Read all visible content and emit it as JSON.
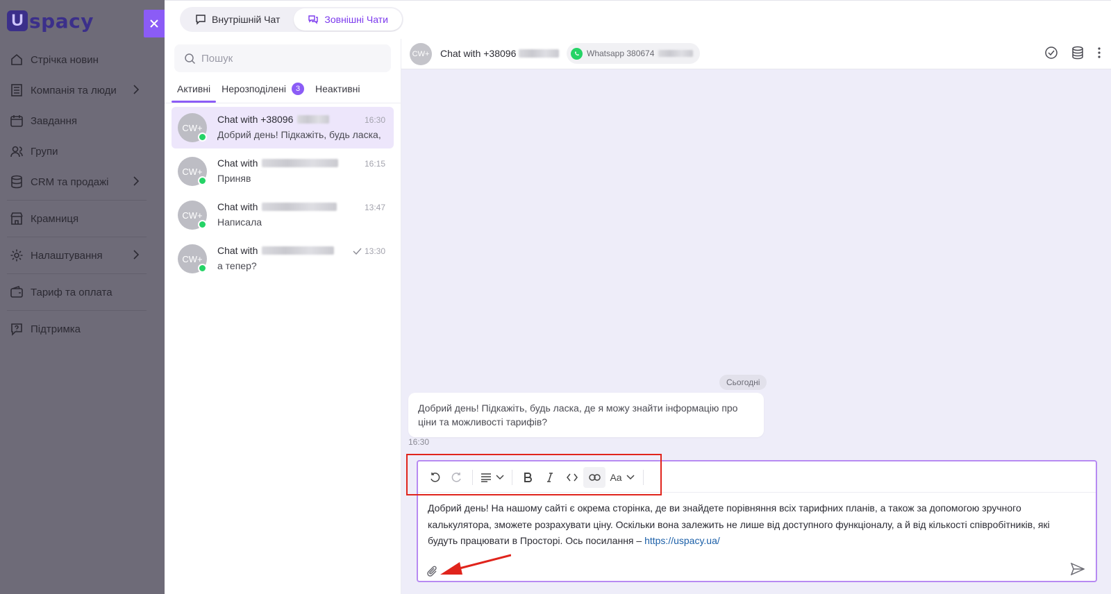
{
  "app": {
    "logo_u": "U",
    "logo_text": "spacy"
  },
  "sidebar": {
    "items": [
      {
        "label": "Стрічка новин",
        "icon": "home-icon"
      },
      {
        "label": "Компанія та люди",
        "icon": "building-icon",
        "chevron": true
      },
      {
        "label": "Завдання",
        "icon": "calendar-icon"
      },
      {
        "label": "Групи",
        "icon": "users-icon"
      },
      {
        "label": "CRM та продажі",
        "icon": "database-icon",
        "chevron": true
      },
      {
        "label": "Крамниця",
        "icon": "store-icon"
      },
      {
        "label": "Налаштування",
        "icon": "gear-icon",
        "chevron": true
      },
      {
        "label": "Тариф та оплата",
        "icon": "wallet-icon"
      },
      {
        "label": "Підтримка",
        "icon": "help-icon"
      }
    ]
  },
  "topbar": {
    "tabs": [
      {
        "label": "Внутрішній Чат",
        "active": false
      },
      {
        "label": "Зовнішні Чати",
        "active": true
      }
    ]
  },
  "chat_list": {
    "search_placeholder": "Пошук",
    "subtabs": [
      {
        "label": "Активні",
        "active": true
      },
      {
        "label": "Нерозподілені",
        "badge": "3"
      },
      {
        "label": "Неактивні"
      }
    ],
    "items": [
      {
        "avatar": "CW+",
        "title": "Chat with +38096",
        "time": "16:30",
        "message": "Добрий день! Підкажіть, будь ласка,",
        "active": true
      },
      {
        "avatar": "CW+",
        "title": "Chat with",
        "time": "16:15",
        "message": "Приняв"
      },
      {
        "avatar": "CW+",
        "title": "Chat with",
        "time": "13:47",
        "message": "Написала"
      },
      {
        "avatar": "CW+",
        "title": "Chat with",
        "time": "13:30",
        "message": "а тепер?",
        "read": true
      }
    ]
  },
  "conversation": {
    "avatar": "CW+",
    "title": "Chat with +38096",
    "channel": "Whatsapp 380674",
    "date_label": "Сьогодні",
    "messages": [
      {
        "text": "Добрий день! Підкажіть, будь ласка, де я можу знайти інформацію про ціни та можливості тарифів?",
        "time": "16:30"
      }
    ]
  },
  "composer": {
    "text": "Добрий день! На нашому сайті є окрема сторінка, де ви знайдете порівняння всіх тарифних планів, а також за допомогою зручного калькулятора, зможете розрахувати ціну. Оскільки вона залежить не лише від доступного функціоналу, а й від кількості співробітників, які будуть працювати в Просторі. Ось посилання – ",
    "link": "https://uspacy.ua/",
    "font_label": "Aa"
  },
  "colors": {
    "accent": "#8b5cf6",
    "whatsapp": "#25d366",
    "annotation": "#e0241c"
  }
}
